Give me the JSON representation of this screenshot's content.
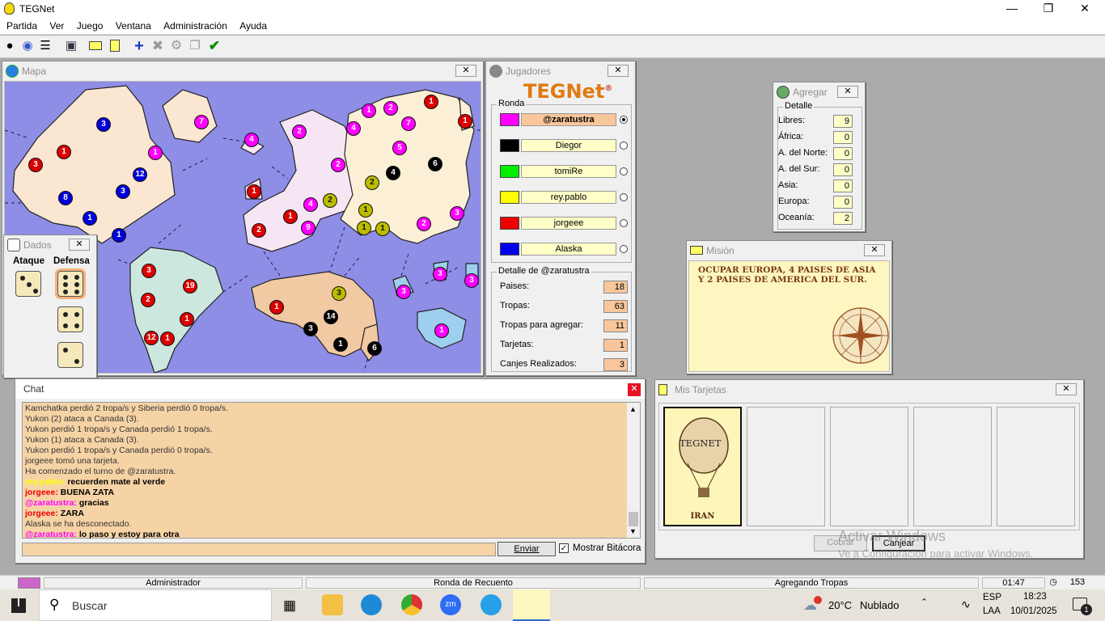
{
  "app": {
    "title": "TEGNet"
  },
  "menu": [
    "Partida",
    "Ver",
    "Juego",
    "Ventana",
    "Administración",
    "Ayuda"
  ],
  "colors": {
    "magenta": "#ff00ff",
    "black": "#000000",
    "green": "#00dd00",
    "yellow": "#ffff00",
    "red": "#ee0000",
    "blue": "#0000dd",
    "chat_bg": "#f6d3a5",
    "detail_value_bg": "#f9c69c"
  },
  "map": {
    "title": "Mapa",
    "armies": [
      {
        "n": "3",
        "c": "blu"
      },
      {
        "n": "1",
        "c": "red"
      },
      {
        "n": "3",
        "c": "red"
      },
      {
        "n": "12",
        "c": "blu"
      },
      {
        "n": "3",
        "c": "blu"
      },
      {
        "n": "8",
        "c": "blu"
      },
      {
        "n": "1",
        "c": "blu"
      },
      {
        "n": "1",
        "c": "blu"
      },
      {
        "n": "1",
        "c": "mag"
      },
      {
        "n": "7",
        "c": "mag"
      },
      {
        "n": "4",
        "c": "mag"
      },
      {
        "n": "2",
        "c": "mag"
      },
      {
        "n": "1",
        "c": "red"
      },
      {
        "n": "2",
        "c": "mag"
      },
      {
        "n": "4",
        "c": "mag"
      },
      {
        "n": "2",
        "c": "yel"
      },
      {
        "n": "1",
        "c": "red"
      },
      {
        "n": "2",
        "c": "red"
      },
      {
        "n": "9",
        "c": "mag"
      },
      {
        "n": "4",
        "c": "mag"
      },
      {
        "n": "1",
        "c": "mag"
      },
      {
        "n": "2",
        "c": "mag"
      },
      {
        "n": "7",
        "c": "mag"
      },
      {
        "n": "1",
        "c": "red"
      },
      {
        "n": "1",
        "c": "red"
      },
      {
        "n": "5",
        "c": "mag"
      },
      {
        "n": "4",
        "c": "blk"
      },
      {
        "n": "6",
        "c": "blk"
      },
      {
        "n": "2",
        "c": "yel"
      },
      {
        "n": "1",
        "c": "yel"
      },
      {
        "n": "1",
        "c": "yel"
      },
      {
        "n": "1",
        "c": "yel"
      },
      {
        "n": "2",
        "c": "mag"
      },
      {
        "n": "3",
        "c": "mag"
      },
      {
        "n": "3",
        "c": "red"
      },
      {
        "n": "19",
        "c": "red"
      },
      {
        "n": "2",
        "c": "red"
      },
      {
        "n": "1",
        "c": "red"
      },
      {
        "n": "12",
        "c": "red"
      },
      {
        "n": "1",
        "c": "red"
      },
      {
        "n": "3",
        "c": "yel"
      },
      {
        "n": "1",
        "c": "red"
      },
      {
        "n": "14",
        "c": "blk"
      },
      {
        "n": "3",
        "c": "blk"
      },
      {
        "n": "1",
        "c": "blk"
      },
      {
        "n": "6",
        "c": "blk"
      },
      {
        "n": "3",
        "c": "mag"
      },
      {
        "n": "3",
        "c": "mag"
      },
      {
        "n": "3",
        "c": "mag"
      },
      {
        "n": "1",
        "c": "mag"
      }
    ]
  },
  "dice": {
    "title": "Dados",
    "attack_label": "Ataque",
    "defense_label": "Defensa",
    "attack": [
      3
    ],
    "defense": [
      6,
      4,
      2
    ]
  },
  "players": {
    "title": "Jugadores",
    "logo": "TEGNet",
    "registered": "®",
    "round_label": "Ronda",
    "list": [
      {
        "name": "@zaratustra",
        "color": "#ff00ff",
        "active": true
      },
      {
        "name": "Diegor",
        "color": "#000000",
        "active": false
      },
      {
        "name": "tomiRe",
        "color": "#00ee00",
        "active": false
      },
      {
        "name": "rey.pablo",
        "color": "#ffff00",
        "active": false
      },
      {
        "name": "jorgeee",
        "color": "#ee0000",
        "active": false
      },
      {
        "name": "Alaska",
        "color": "#0000ee",
        "active": false
      }
    ],
    "detail_label": "Detalle de @zaratustra",
    "detail": [
      {
        "label": "Paises:",
        "value": "18"
      },
      {
        "label": "Tropas:",
        "value": "63"
      },
      {
        "label": "Tropas para agregar:",
        "value": "11"
      },
      {
        "label": "Tarjetas:",
        "value": "1"
      },
      {
        "label": "Canjes Realizados:",
        "value": "3"
      }
    ]
  },
  "agregar": {
    "title": "Agregar",
    "detail_label": "Detalle",
    "rows": [
      {
        "label": "Libres:",
        "value": "9"
      },
      {
        "label": "África:",
        "value": "0"
      },
      {
        "label": "A. del Norte:",
        "value": "0"
      },
      {
        "label": "A. del Sur:",
        "value": "0"
      },
      {
        "label": "Asia:",
        "value": "0"
      },
      {
        "label": "Europa:",
        "value": "0"
      },
      {
        "label": "Oceanía:",
        "value": "2"
      }
    ]
  },
  "mision": {
    "title": "Misión",
    "text": "OCUPAR EUROPA, 4 PAISES DE ASIA Y 2 PAISES DE AMERICA DEL SUR."
  },
  "chat": {
    "title": "Chat",
    "lines": [
      {
        "who": "",
        "t": "Kamchatka perdió 2 tropa/s y Siberia perdió 0 tropa/s.",
        "color": "#000"
      },
      {
        "who": "",
        "t": "Yukon (2) ataca a Canada (3).",
        "color": "#000"
      },
      {
        "who": "",
        "t": "Yukon perdió 1 tropa/s y Canada perdió 1 tropa/s.",
        "color": "#000"
      },
      {
        "who": "",
        "t": "Yukon (1) ataca a Canada (3).",
        "color": "#000"
      },
      {
        "who": "",
        "t": "Yukon perdió 1 tropa/s y Canada perdió 0 tropa/s.",
        "color": "#000"
      },
      {
        "who": "",
        "t": "jorgeee tomó una tarjeta.",
        "color": "#000"
      },
      {
        "who": "",
        "t": "Ha comenzado el turno de @zaratustra.",
        "color": "#000"
      },
      {
        "who": "rey.pablo:",
        "t": " recuerden mate al verde",
        "color": "#ffff00"
      },
      {
        "who": "jorgeee:",
        "t": " BUENA ZATA",
        "color": "#ee0000"
      },
      {
        "who": "@zaratustra:",
        "t": " gracias",
        "color": "#ff00ff"
      },
      {
        "who": "jorgeee:",
        "t": " ZARA",
        "color": "#ee0000"
      },
      {
        "who": "",
        "t": "Alaska se ha desconectado.",
        "color": "#000"
      },
      {
        "who": "@zaratustra:",
        "t": " lo paso y estoy para otra",
        "color": "#ff00ff"
      }
    ],
    "input_value": "",
    "send_label": "Enviar",
    "show_log_label": "Mostrar Bitácora"
  },
  "tarjetas": {
    "title": "Mis Tarjetas",
    "cards": [
      {
        "logo": "TEGNET",
        "country": "IRAN"
      }
    ],
    "collect_label": "Cobrar",
    "exchange_label": "Canjear"
  },
  "watermark": {
    "line1": "Activar Windows",
    "line2": "Ve a Configuración para activar Windows."
  },
  "status": {
    "role": "Administrador",
    "phase": "Ronda de Recuento",
    "action": "Agregando Tropas",
    "timer": "01:47",
    "count": "153"
  },
  "taskbar": {
    "search": "Buscar",
    "weather_temp": "20°C",
    "weather_desc": "Nublado",
    "lang1": "ESP",
    "lang2": "LAA",
    "time": "18:23",
    "date": "10/01/2025",
    "notif": "1"
  }
}
